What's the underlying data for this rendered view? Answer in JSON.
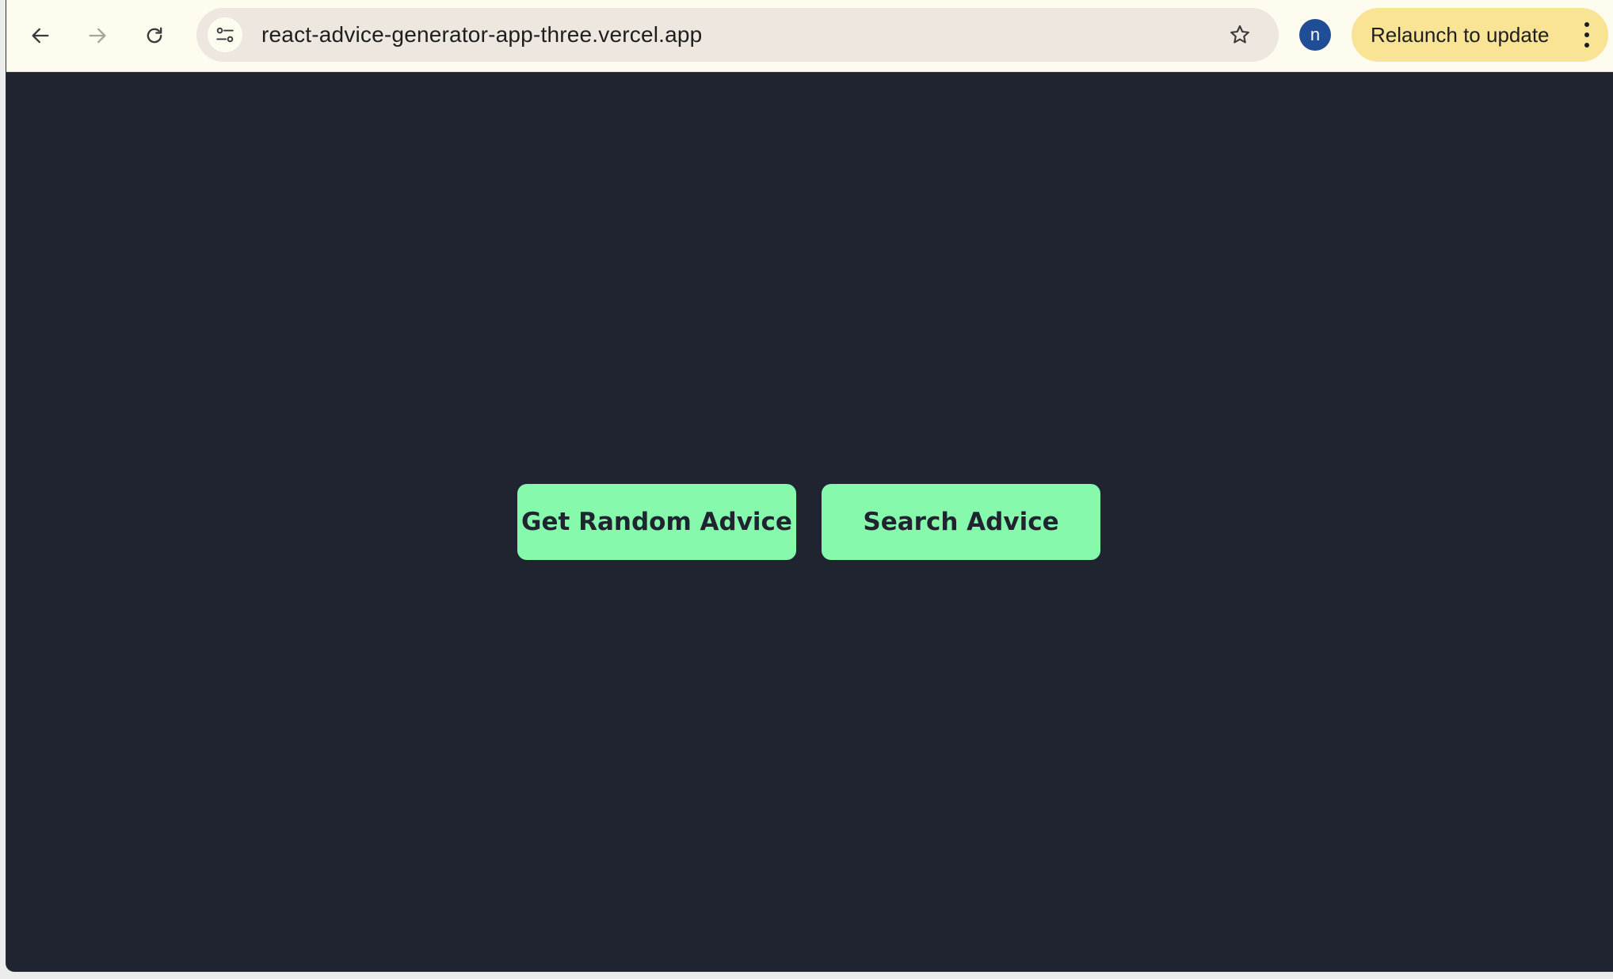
{
  "browser": {
    "url": "react-advice-generator-app-three.vercel.app",
    "profile_initial": "n",
    "relaunch_label": "Relaunch to update",
    "colors": {
      "toolbar": "#fefbef",
      "omnibox": "#ede7df",
      "relaunch": "#f9e394",
      "avatar": "#1f4e96"
    },
    "icons": [
      "back-arrow-icon",
      "forward-arrow-icon",
      "reload-icon",
      "site-settings-icon",
      "bookmark-star-icon",
      "more-vertical-icon"
    ]
  },
  "app": {
    "background": "#1f2430",
    "accent": "#86f9ac",
    "buttons": {
      "random_label": "Get Random Advice",
      "search_label": "Search Advice"
    }
  }
}
